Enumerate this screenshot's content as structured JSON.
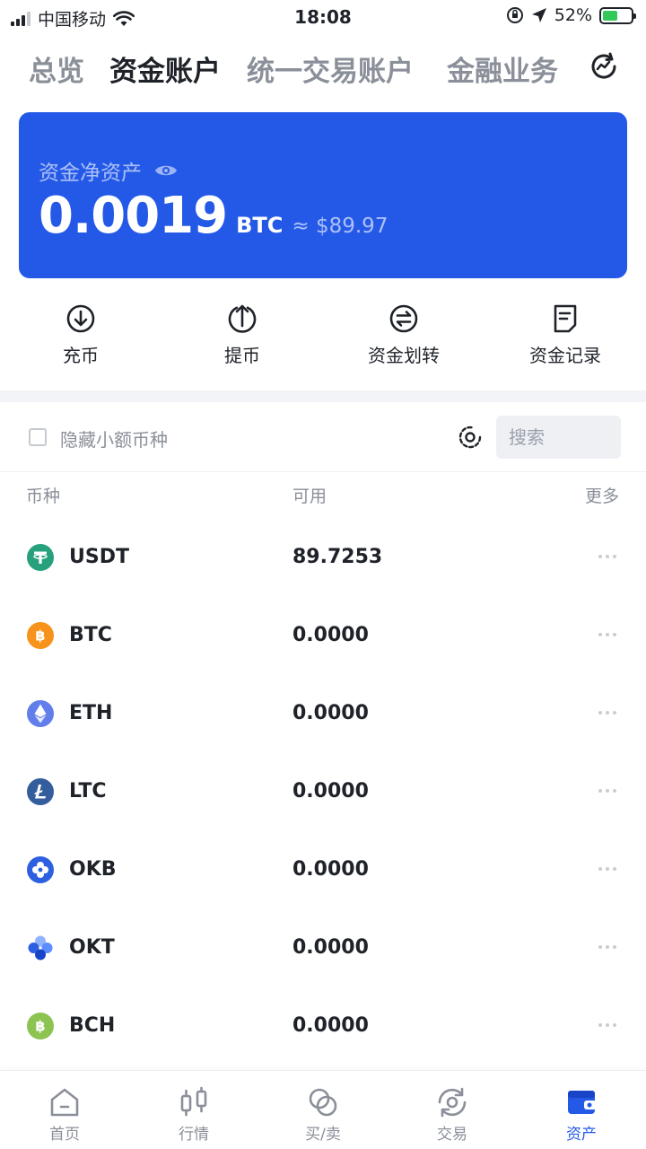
{
  "status": {
    "carrier": "中国移动",
    "time": "18:08",
    "battery": "52%"
  },
  "tabs": [
    {
      "label": "总览"
    },
    {
      "label": "资金账户"
    },
    {
      "label": "统一交易账户"
    },
    {
      "label": "金融业务"
    }
  ],
  "card": {
    "label": "资金净资产",
    "value": "0.0019",
    "unit": "BTC",
    "approx": "≈ $89.97"
  },
  "actions": [
    {
      "label": "充币",
      "icon": "deposit-icon"
    },
    {
      "label": "提币",
      "icon": "withdraw-icon"
    },
    {
      "label": "资金划转",
      "icon": "transfer-icon"
    },
    {
      "label": "资金记录",
      "icon": "record-icon"
    }
  ],
  "filter": {
    "hide_small": "隐藏小额币种",
    "search_placeholder": "搜索"
  },
  "table": {
    "headers": {
      "coin": "币种",
      "available": "可用",
      "more": "更多"
    },
    "rows": [
      {
        "coin": "USDT",
        "available": "89.7253",
        "color": "#26a17b"
      },
      {
        "coin": "BTC",
        "available": "0.0000",
        "color": "#f7931a"
      },
      {
        "coin": "ETH",
        "available": "0.0000",
        "color": "#627eea"
      },
      {
        "coin": "LTC",
        "available": "0.0000",
        "color": "#345d9d"
      },
      {
        "coin": "OKB",
        "available": "0.0000",
        "color": "#2d60e0"
      },
      {
        "coin": "OKT",
        "available": "0.0000",
        "color": "#3b6ff0"
      },
      {
        "coin": "BCH",
        "available": "0.0000",
        "color": "#8dc351"
      }
    ]
  },
  "nav": [
    {
      "label": "首页",
      "icon": "home-icon"
    },
    {
      "label": "行情",
      "icon": "market-icon"
    },
    {
      "label": "买/卖",
      "icon": "buy-sell-icon"
    },
    {
      "label": "交易",
      "icon": "trade-icon"
    },
    {
      "label": "资产",
      "icon": "wallet-icon",
      "active": true
    }
  ],
  "colors": {
    "accent": "#2459e8",
    "text": "#1f2329",
    "muted": "#8a8f99"
  }
}
